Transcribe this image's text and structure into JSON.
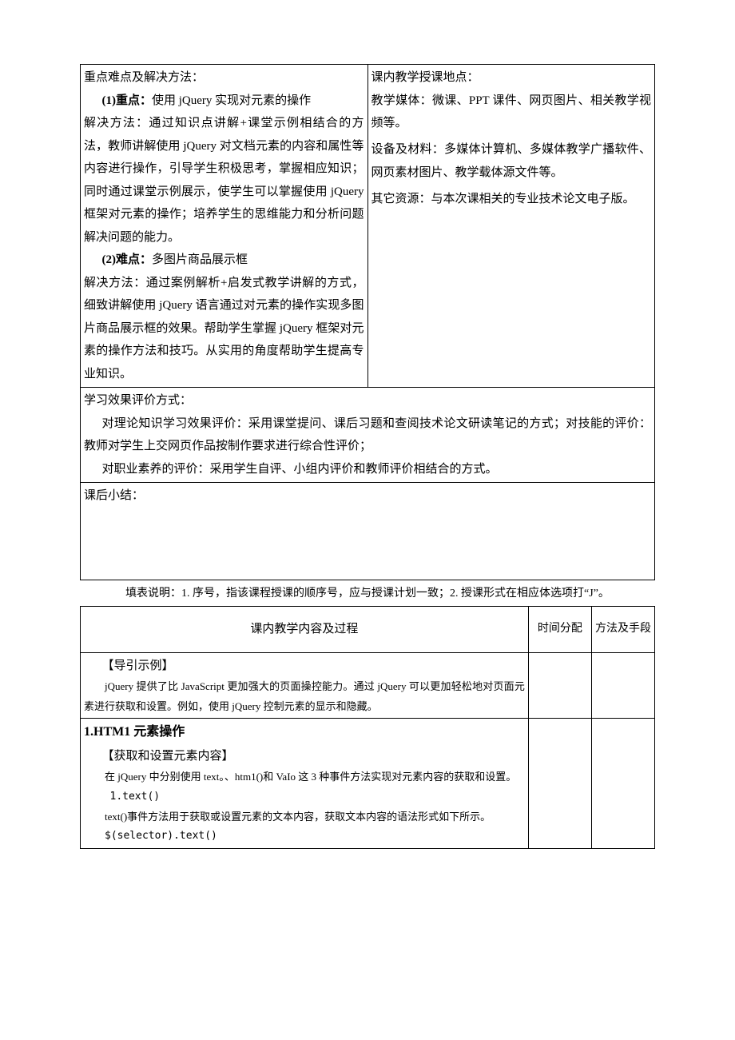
{
  "table1": {
    "left": {
      "heading": "重点难点及解决方法：",
      "p1_label": "(1)重点：",
      "p1_text": "使用 jQuery 实现对元素的操作",
      "p1_body": "解决方法：通过知识点讲解+课堂示例相结合的方法，教师讲解使用 jQuery 对文档元素的内容和属性等内容进行操作，引导学生积极思考，掌握相应知识；同时通过课堂示例展示，使学生可以掌握使用 jQuery 框架对元素的操作；培养学生的思维能力和分析问题解决问题的能力。",
      "p2_label": "(2)难点：",
      "p2_text": "多图片商品展示框",
      "p2_body": "解决方法：通过案例解析+启发式教学讲解的方式，细致讲解使用 jQuery 语言通过对元素的操作实现多图片商品展示框的效果。帮助学生掌握 jQuery 框架对元素的操作方法和技巧。从实用的角度帮助学生提高专业知识。"
    },
    "right": {
      "loc_label": "课内教学授课地点：",
      "media_label": "教学媒体：",
      "media_text": "微课、PPT 课件、网页图片、相关教学视频等。",
      "equip_label": "设备及材料：",
      "equip_text": "多媒体计算机、多媒体教学广播软件、网页素材图片、教学载体源文件等。",
      "other_label": "其它资源：",
      "other_text": "与本次课相关的专业技术论文电子版。"
    },
    "eval": {
      "heading": "学习效果评价方式：",
      "line1": "对理论知识学习效果评价：采用课堂提问、课后习题和查阅技术论文研读笔记的方式；对技能的评价：教师对学生上交网页作品按制作要求进行综合性评价；",
      "line2": "对职业素养的评价：采用学生自评、小组内评价和教师评价相结合的方式。"
    },
    "summary": {
      "heading": "课后小结："
    }
  },
  "note": "填表说明：1. 序号，指该课程授课的顺序号，应与授课计划一致；2. 授课形式在相应体选项打“J”。",
  "table2": {
    "head": {
      "content": "课内教学内容及过程",
      "time": "时间分配",
      "method": "方法及手段"
    },
    "row1": {
      "h": "【导引示例】",
      "p": "jQuery 提供了比 JavaScript 更加强大的页面操控能力。通过 jQuery 可以更加轻松地对页面元素进行获取和设置。例如，使用 jQuery 控制元素的显示和隐藏。"
    },
    "row2": {
      "title": "1.HTM1 元素操作",
      "h": "【获取和设置元素内容】",
      "p1": "在 jQuery 中分别使用 text。、htm1()和 VaIo 这 3 种事件方法实现对元素内容的获取和设置。",
      "c1": "1.text()",
      "p2": "text()事件方法用于获取或设置元素的文本内容，获取文本内容的语法形式如下所示。",
      "c2": "$(selector).text()"
    }
  }
}
